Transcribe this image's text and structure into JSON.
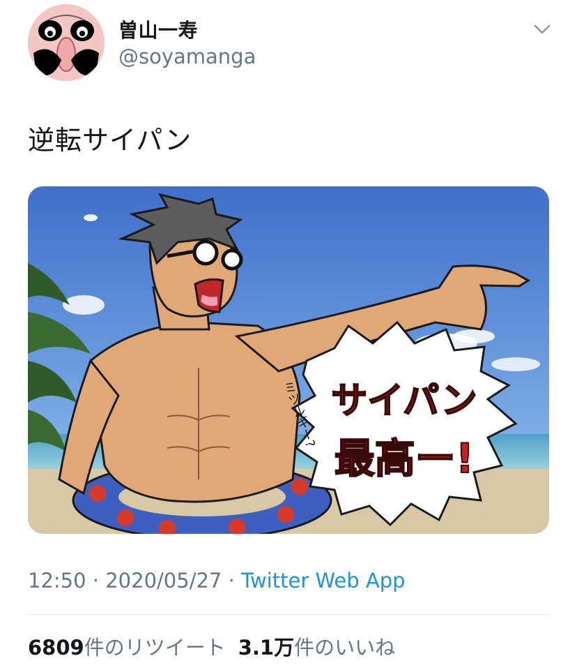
{
  "tweet": {
    "author": {
      "display_name": "曽山一寿",
      "handle": "@soyamanga"
    },
    "text": "逆転サイパン",
    "image": {
      "bubble_main": "サイパン最高ー!",
      "bubble_side": "ミツルギー?"
    },
    "meta": {
      "time": "12:50",
      "separator": " · ",
      "date": "2020/05/27",
      "source": "Twitter Web App"
    },
    "stats": {
      "retweets_count": "6809",
      "retweets_label": "件のリツイート",
      "likes_count": "3.1万",
      "likes_label": "件のいいね"
    }
  },
  "icons": {
    "menu": "chevron-down-icon",
    "avatar": "caricature-face-avatar"
  },
  "colors": {
    "text": "#14171a",
    "secondary": "#657786",
    "link": "#1b95e0",
    "divider": "#dfe3e7"
  }
}
